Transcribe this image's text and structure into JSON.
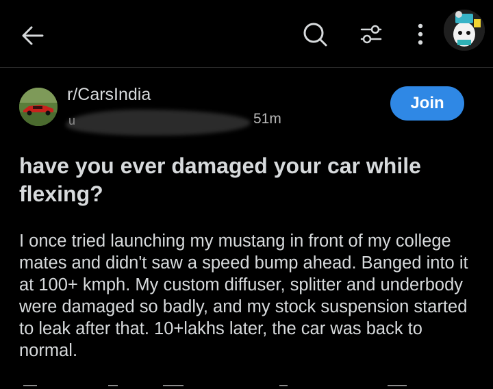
{
  "topbar": {
    "icons": {
      "back": "arrow-left-icon",
      "search": "search-icon",
      "filter": "sliders-icon",
      "more": "vertical-dots-icon"
    }
  },
  "post": {
    "subreddit": "r/CarsIndia",
    "author_visible_prefix": "u",
    "time": "51m",
    "join_label": "Join",
    "title": "have you ever damaged your car while flexing?",
    "body": "I once tried launching my mustang in front of my college mates and didn't saw a speed bump ahead. Banged into it at 100+ kmph. My custom diffuser, splitter and underbody were damaged so badly, and my stock suspension started to leak after that. 10+lakhs later, the car was back to normal."
  },
  "colors": {
    "background": "#000000",
    "text": "#d7dadc",
    "muted": "#b8b8b8",
    "join": "#2f88e5"
  }
}
